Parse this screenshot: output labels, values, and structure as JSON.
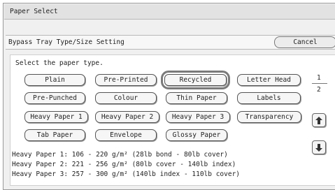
{
  "window": {
    "title": "Paper Select"
  },
  "header": {
    "subtitle": "Bypass Tray Type/Size Setting",
    "cancel_label": "Cancel"
  },
  "prompt": "Select the paper type.",
  "paper_types": [
    "Plain",
    "Pre-Printed",
    "Recycled",
    "Letter Head",
    "Pre-Punched",
    "Colour",
    "Thin Paper",
    "Labels",
    "Heavy Paper 1",
    "Heavy Paper 2",
    "Heavy Paper 3",
    "Transparency",
    "Tab Paper",
    "Envelope",
    "Glossy Paper"
  ],
  "selected_type": "Recycled",
  "pagination": {
    "current": "1",
    "total": "2"
  },
  "icons": {
    "up": "arrow-up-icon",
    "down": "arrow-down-icon"
  },
  "info": [
    "Heavy Paper 1: 106 - 220 g/m² (28lb bond - 80lb cover)",
    "Heavy Paper 2: 221 - 256 g/m² (80lb cover - 140lb index)",
    "Heavy Paper 3: 257 - 300 g/m² (140lb index - 110lb cover)"
  ]
}
